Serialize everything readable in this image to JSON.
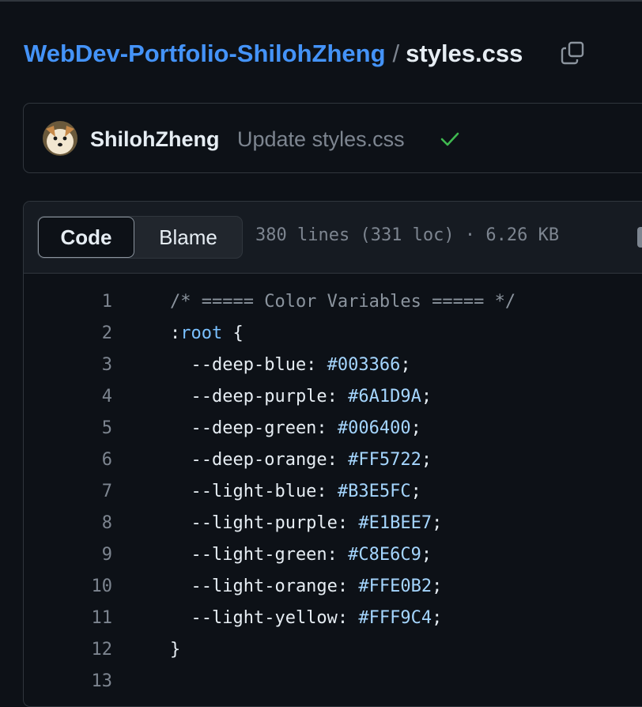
{
  "breadcrumb": {
    "repo": "WebDev-Portfolio-ShilohZheng",
    "separator": "/",
    "file": "styles.css"
  },
  "commit": {
    "author": "ShilohZheng",
    "message": "Update styles.css",
    "status": "check-icon",
    "status_color": "#3fb950"
  },
  "file_header": {
    "tabs": {
      "code": "Code",
      "blame": "Blame"
    },
    "meta": "380 lines (331 loc) · 6.26 KB"
  },
  "colors": {
    "background": "#0d1117",
    "link": "#4493f8",
    "muted": "#7d8590",
    "border": "#30363d"
  },
  "code_lines": [
    {
      "num": "1",
      "parts": [
        {
          "t": "/* ===== Color Variables ===== */",
          "c": "comment"
        }
      ]
    },
    {
      "num": "2",
      "parts": [
        {
          "t": ":"
        },
        {
          "t": "root",
          "c": "sel"
        },
        {
          "t": " {"
        }
      ]
    },
    {
      "num": "3",
      "parts": [
        {
          "t": "  --deep-blue: "
        },
        {
          "t": "#003366",
          "c": "val"
        },
        {
          "t": ";"
        }
      ]
    },
    {
      "num": "4",
      "parts": [
        {
          "t": "  --deep-purple: "
        },
        {
          "t": "#6A1D9A",
          "c": "val"
        },
        {
          "t": ";"
        }
      ]
    },
    {
      "num": "5",
      "parts": [
        {
          "t": "  --deep-green: "
        },
        {
          "t": "#006400",
          "c": "val"
        },
        {
          "t": ";"
        }
      ]
    },
    {
      "num": "6",
      "parts": [
        {
          "t": "  --deep-orange: "
        },
        {
          "t": "#FF5722",
          "c": "val"
        },
        {
          "t": ";"
        }
      ]
    },
    {
      "num": "7",
      "parts": [
        {
          "t": "  --light-blue: "
        },
        {
          "t": "#B3E5FC",
          "c": "val"
        },
        {
          "t": ";"
        }
      ]
    },
    {
      "num": "8",
      "parts": [
        {
          "t": "  --light-purple: "
        },
        {
          "t": "#E1BEE7",
          "c": "val"
        },
        {
          "t": ";"
        }
      ]
    },
    {
      "num": "9",
      "parts": [
        {
          "t": "  --light-green: "
        },
        {
          "t": "#C8E6C9",
          "c": "val"
        },
        {
          "t": ";"
        }
      ]
    },
    {
      "num": "10",
      "parts": [
        {
          "t": "  --light-orange: "
        },
        {
          "t": "#FFE0B2",
          "c": "val"
        },
        {
          "t": ";"
        }
      ]
    },
    {
      "num": "11",
      "parts": [
        {
          "t": "  --light-yellow: "
        },
        {
          "t": "#FFF9C4",
          "c": "val"
        },
        {
          "t": ";"
        }
      ]
    },
    {
      "num": "12",
      "parts": [
        {
          "t": "}"
        }
      ]
    },
    {
      "num": "13",
      "parts": []
    }
  ]
}
